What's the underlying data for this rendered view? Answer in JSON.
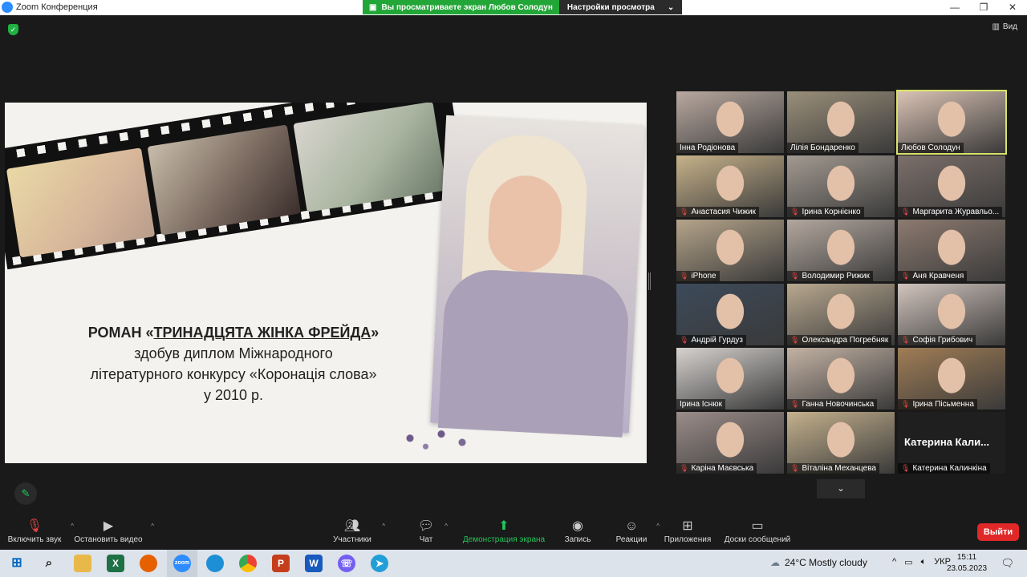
{
  "window": {
    "title": "Zoom Конференция"
  },
  "share_banner": {
    "viewing": "Вы просматриваете экран Любов Солодун",
    "settings": "Настройки просмотра"
  },
  "view_button": "Вид",
  "slide": {
    "line1_prefix": "РОМАН «",
    "line1_title": "ТРИНАДЦЯТА ЖІНКА ФРЕЙДА",
    "line1_suffix": "»",
    "line2": "здобув диплом Міжнародного",
    "line3": "літературного конкурсу «Коронація слова»",
    "line4": "у 2010 р."
  },
  "participants": [
    {
      "name": "Інна Родіонова",
      "muted": false,
      "color": "#b9a9a0"
    },
    {
      "name": "Лілія Бондаренко",
      "muted": false,
      "color": "#9a8f7a"
    },
    {
      "name": "Любов Солодун",
      "muted": false,
      "color": "#d9c2b4",
      "active": true
    },
    {
      "name": "Анастасия Чижик",
      "muted": true,
      "color": "#c7b28a"
    },
    {
      "name": "Ірина Корнієнко",
      "muted": true,
      "color": "#a39a91"
    },
    {
      "name": "Маргарита Журавльо...",
      "muted": true,
      "color": "#7b6f6a"
    },
    {
      "name": "iPhone",
      "muted": true,
      "color": "#b5a48a"
    },
    {
      "name": "Володимир Рижик",
      "muted": true,
      "color": "#b3a79e"
    },
    {
      "name": "Аня Кравченя",
      "muted": true,
      "color": "#8c7a70"
    },
    {
      "name": "Андрій Гурдуз",
      "muted": true,
      "color": "#3c4a5a"
    },
    {
      "name": "Олександра Погребняк",
      "muted": true,
      "color": "#b8a88f"
    },
    {
      "name": "Софія Грибович",
      "muted": true,
      "color": "#d1c4bd"
    },
    {
      "name": "Ірина Існюк",
      "muted": false,
      "color": "#d6d2cf"
    },
    {
      "name": "Ганна Новочинська",
      "muted": true,
      "color": "#c3b2a4"
    },
    {
      "name": "Ірина Пісьменна",
      "muted": true,
      "color": "#a07d55"
    },
    {
      "name": "Каріна Маєвська",
      "muted": true,
      "color": "#9a8c89"
    },
    {
      "name": "Віталіна Механцева",
      "muted": true,
      "color": "#c4b18d"
    },
    {
      "name": "Катерина Калинкіна",
      "muted": true,
      "color": "#2a2a2a",
      "big_label": "Катерина Кали..."
    }
  ],
  "toolbar": {
    "unmute": "Включить звук",
    "stop_video": "Остановить видео",
    "participants": "Участники",
    "participants_count": "26",
    "chat": "Чат",
    "share": "Демонстрация экрана",
    "record": "Запись",
    "reactions": "Реакции",
    "apps": "Приложения",
    "whiteboards": "Доски сообщений",
    "leave": "Выйти"
  },
  "taskbar": {
    "weather": "24°C  Mostly cloudy",
    "lang": "УКР",
    "time": "15:11",
    "date": "23.05.2023"
  }
}
